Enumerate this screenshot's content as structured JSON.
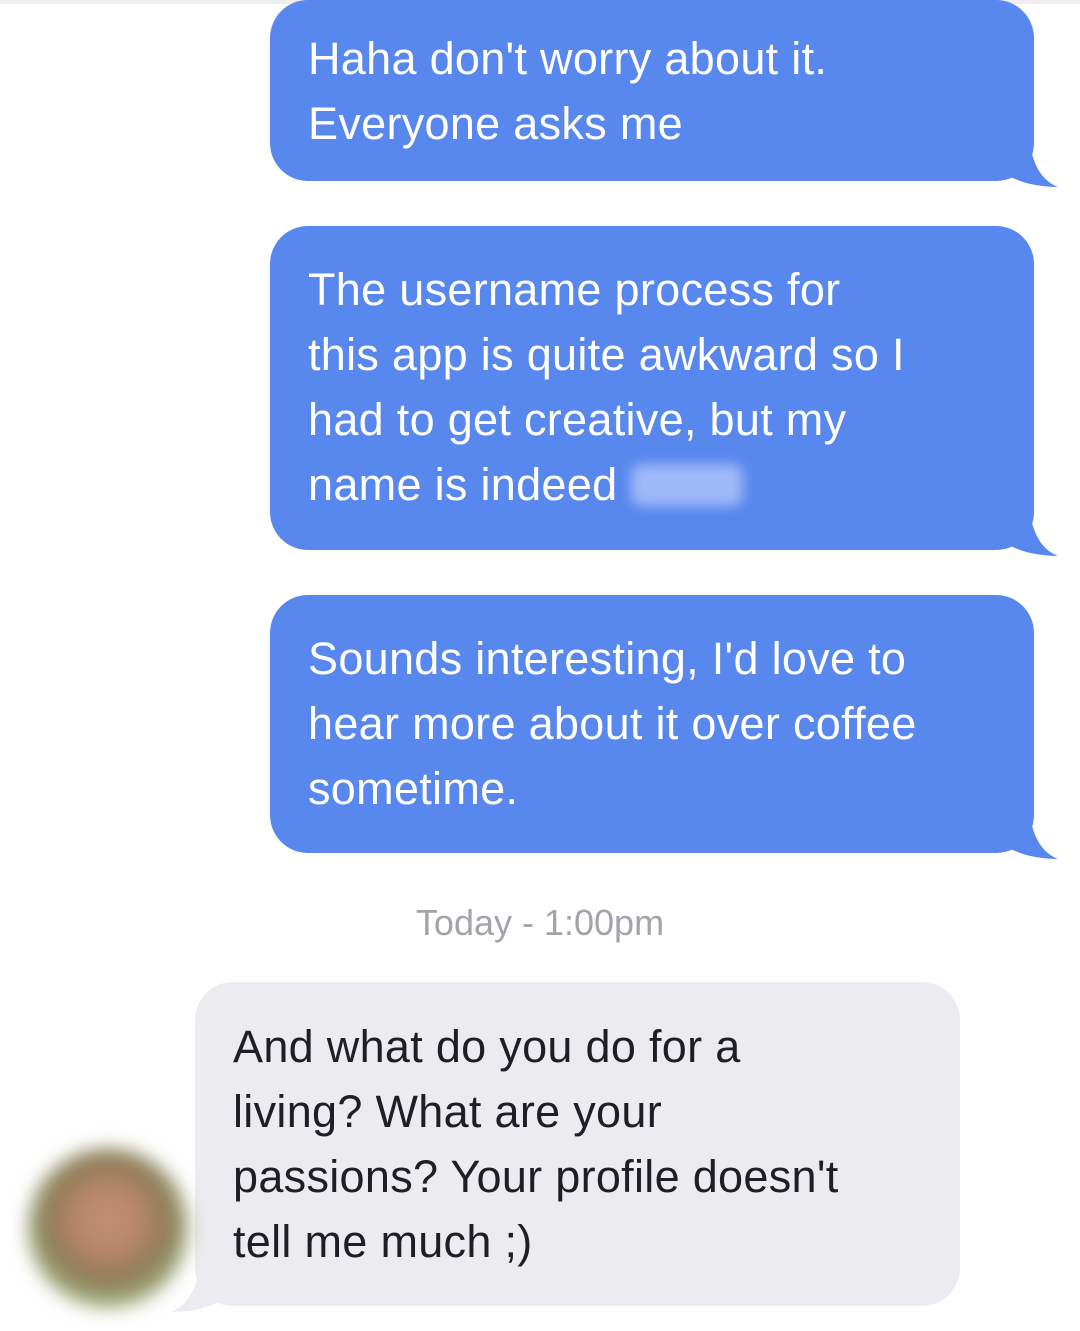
{
  "messages": [
    {
      "from": "me",
      "lines": [
        "Haha don't worry about it.",
        "Everyone asks me"
      ]
    },
    {
      "from": "me",
      "lines": [
        "The username process for",
        "this app is quite awkward so I",
        "had to get creative, but my",
        "name is indeed"
      ],
      "redacted": true
    },
    {
      "from": "me",
      "lines": [
        "Sounds interesting, I'd love to",
        "hear more about it over coffee",
        "sometime."
      ]
    },
    {
      "from": "them",
      "lines": [
        "And what do you do for a",
        "living? What are your",
        "passions? Your profile doesn't",
        "tell me much ;)"
      ]
    }
  ],
  "timestamp": "Today - 1:00pm",
  "colors": {
    "sent_bubble": "#5887ee",
    "received_bubble": "#ececf0",
    "timestamp": "#a3a3a9"
  }
}
